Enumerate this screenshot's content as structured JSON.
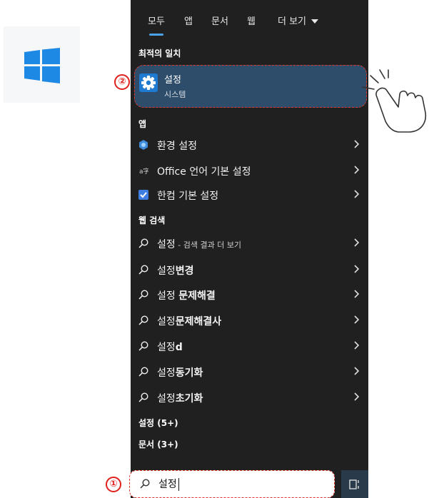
{
  "tabs": [
    {
      "label": "모두"
    },
    {
      "label": "앱"
    },
    {
      "label": "문서"
    },
    {
      "label": "웹"
    },
    {
      "label": "더 보기"
    }
  ],
  "sections": {
    "best_match": "최적의 일치",
    "apps": "앱",
    "web": "웹 검색",
    "settings_more": "설정 (5+)",
    "docs_more": "문서 (3+)"
  },
  "best_match": {
    "title": "설정",
    "subtitle": "시스템",
    "icon": "gear-icon"
  },
  "apps": [
    {
      "label": "환경 설정",
      "icon": "control-panel-icon"
    },
    {
      "label": "Office 언어 기본 설정",
      "icon": "office-language-icon"
    },
    {
      "label": "한컴 기본 설정",
      "icon": "hancom-settings-icon"
    }
  ],
  "web": [
    {
      "main": "설정",
      "suffix": " - 검색 결과 더 보기"
    },
    {
      "main": "설정",
      "bold": "변경"
    },
    {
      "main": "설정 ",
      "bold": "문제해결"
    },
    {
      "main": "설정",
      "bold": "문제해결사"
    },
    {
      "main": "설정",
      "bold": "d"
    },
    {
      "main": "설정",
      "bold": "동기화"
    },
    {
      "main": "설정",
      "bold": "초기화"
    }
  ],
  "search": {
    "value": "설정"
  },
  "annotations": {
    "step1": "①",
    "step2": "②"
  },
  "colors": {
    "panel": "#202020",
    "highlight": "#2e4d6a",
    "accent": "#4aa3e8",
    "annotation": "#e0382b"
  }
}
